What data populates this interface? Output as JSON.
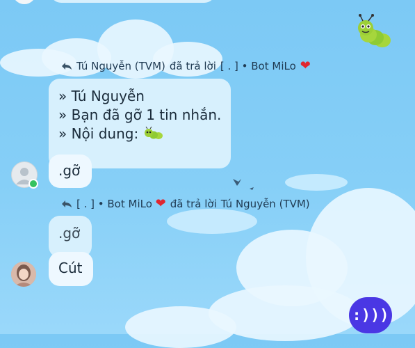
{
  "message1": {
    "reply_header": {
      "author": "Tú Nguyễn (TVM)",
      "verb": "đã trả lời",
      "target": "[ . ] • Bot MiLo"
    },
    "quoted_lines": [
      "» Tú Nguyễn",
      "» Bạn đã gỡ 1 tin nhắn.",
      "» Nội dung:"
    ],
    "text": ".gỡ"
  },
  "message2": {
    "reply_header": {
      "author": "[ . ] • Bot MiLo",
      "verb": "đã trả lời",
      "target": "Tú Nguyễn (TVM)"
    },
    "quoted_text": ".gỡ",
    "text": "Cút"
  },
  "fab": {
    "label": ":)))"
  },
  "colors": {
    "accent": "#4a37e4",
    "heart": "#e0262f",
    "online": "#35c25e",
    "bubble": "#d7f0fd"
  },
  "icons": [
    "reply-arrow-icon",
    "heart-icon",
    "caterpillar-sticker",
    "default-avatar-icon"
  ]
}
